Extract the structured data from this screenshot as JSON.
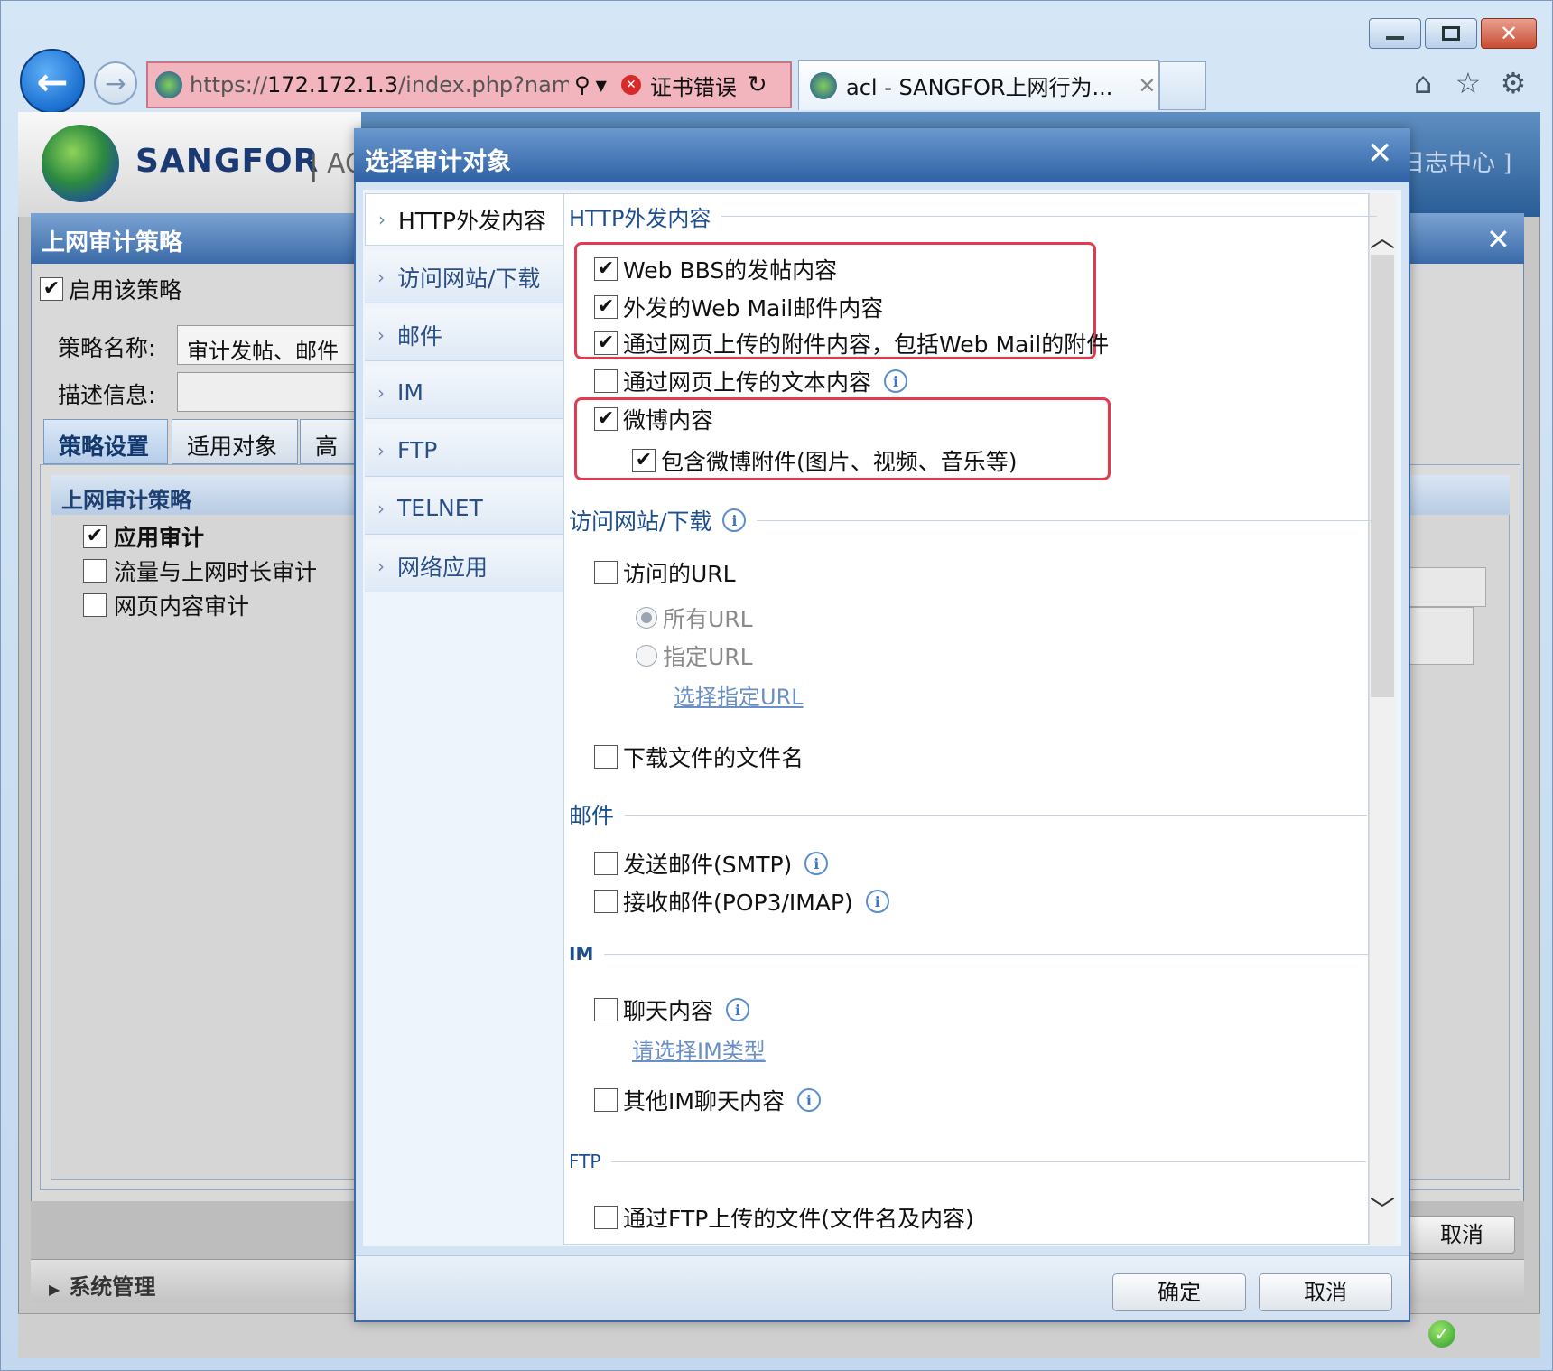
{
  "browser": {
    "url_prefix": "https://",
    "url_host": "172.172.1.3",
    "url_rest": "/index.php?name",
    "cert_error": "证书错误",
    "tab_title": "acl - SANGFOR上网行为..."
  },
  "header": {
    "logo_text": "SANGFOR",
    "logo_separator": "|",
    "logo_product": "AC",
    "right_link": "日志中心 ]"
  },
  "policy_panel": {
    "title": "上网审计策略",
    "enable_label": "启用该策略",
    "name_label": "策略名称:",
    "name_value": "审计发帖、邮件",
    "desc_label": "描述信息:",
    "tabs": [
      "策略设置",
      "适用对象",
      "高级"
    ],
    "tree_title": "上网审计策略",
    "tree_items": [
      "应用审计",
      "流量与上网时长审计",
      "网页内容审计"
    ],
    "cancel_label": "取消",
    "system_mgmt": "系统管理"
  },
  "dialog": {
    "title": "选择审计对象",
    "nav": [
      "HTTP外发内容",
      "访问网站/下载",
      "邮件",
      "IM",
      "FTP",
      "TELNET",
      "网络应用"
    ],
    "sections": {
      "http": {
        "title": "HTTP外发内容",
        "opt_bbs": "Web BBS的发帖内容",
        "opt_webmail": "外发的Web Mail邮件内容",
        "opt_attach": "通过网页上传的附件内容，包括Web Mail的附件",
        "opt_text": "通过网页上传的文本内容",
        "opt_weibo": "微博内容",
        "opt_weibo_attach": "包含微博附件(图片、视频、音乐等)"
      },
      "web": {
        "title": "访问网站/下载",
        "opt_url": "访问的URL",
        "radio_all": "所有URL",
        "radio_specific": "指定URL",
        "link_select": "选择指定URL",
        "opt_download": "下载文件的文件名"
      },
      "mail": {
        "title": "邮件",
        "opt_smtp": "发送邮件(SMTP)",
        "opt_pop3": "接收邮件(POP3/IMAP)"
      },
      "im": {
        "title": "IM",
        "opt_chat": "聊天内容",
        "link_im_type": "请选择IM类型",
        "opt_other": "其他IM聊天内容"
      },
      "ftp": {
        "title": "FTP",
        "opt_upload": "通过FTP上传的文件(文件名及内容)"
      }
    },
    "ok_label": "确定",
    "cancel_label": "取消"
  },
  "colors": {
    "highlight_box": "#e23a4f",
    "title_bar": "#2f61a4",
    "section_heading": "#1d4f8f"
  }
}
